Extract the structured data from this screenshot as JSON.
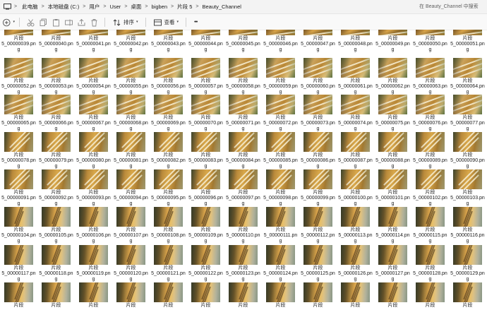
{
  "address_bar": {
    "breadcrumbs": [
      "此电脑",
      "本地磁盘 (C:)",
      "用户",
      "User",
      "桌面",
      "bigben",
      "片段 5",
      "Beauty_Channel"
    ],
    "search_placeholder": "在 Beauty_Channel 中搜索"
  },
  "toolbar": {
    "sort_label": "排序",
    "view_label": "查看",
    "more_label": "•••"
  },
  "files": {
    "first_partial_index": 39,
    "name_prefix": "片段",
    "name_suffix": ".png",
    "rows": [
      [
        {
          "line1": "5_00000039.pn",
          "line2": "g"
        },
        {
          "line1": "5_00000040.pn",
          "line2": "g"
        },
        {
          "line1": "5_00000041.pn",
          "line2": "g"
        },
        {
          "line1": "5_00000042.pn",
          "line2": "g"
        },
        {
          "line1": "5_00000043.pn",
          "line2": "g"
        },
        {
          "line1": "5_00000044.pn",
          "line2": "g"
        },
        {
          "line1": "5_00000045.pn",
          "line2": "g"
        },
        {
          "line1": "5_00000046.pn",
          "line2": "g"
        },
        {
          "line1": "5_00000047.pn",
          "line2": "g"
        },
        {
          "line1": "5_00000048.pn",
          "line2": "g"
        },
        {
          "line1": "5_00000049.pn",
          "line2": "g"
        },
        {
          "line1": "5_00000050.pn",
          "line2": "g"
        },
        {
          "line1": "5_00000051.pn",
          "line2": "g"
        }
      ],
      [
        {
          "line1": "5_00000052.pn",
          "line2": "g"
        },
        {
          "line1": "5_00000053.pn",
          "line2": "g"
        },
        {
          "line1": "5_00000054.pn",
          "line2": "g"
        },
        {
          "line1": "5_00000055.pn",
          "line2": "g"
        },
        {
          "line1": "5_00000056.pn",
          "line2": "g"
        },
        {
          "line1": "5_00000057.pn",
          "line2": "g"
        },
        {
          "line1": "5_00000058.pn",
          "line2": "g"
        },
        {
          "line1": "5_00000059.pn",
          "line2": "g"
        },
        {
          "line1": "5_00000060.pn",
          "line2": "g"
        },
        {
          "line1": "5_00000061.pn",
          "line2": "g"
        },
        {
          "line1": "5_00000062.pn",
          "line2": "g"
        },
        {
          "line1": "5_00000063.pn",
          "line2": "g"
        },
        {
          "line1": "5_00000064.pn",
          "line2": "g"
        }
      ],
      [
        {
          "line1": "5_00000065.pn",
          "line2": "g"
        },
        {
          "line1": "5_00000066.pn",
          "line2": "g"
        },
        {
          "line1": "5_00000067.pn",
          "line2": "g"
        },
        {
          "line1": "5_00000068.pn",
          "line2": "g"
        },
        {
          "line1": "5_00000069.pn",
          "line2": "g"
        },
        {
          "line1": "5_00000070.pn",
          "line2": "g"
        },
        {
          "line1": "5_00000071.pn",
          "line2": "g"
        },
        {
          "line1": "5_00000072.pn",
          "line2": "g"
        },
        {
          "line1": "5_00000073.pn",
          "line2": "g"
        },
        {
          "line1": "5_00000074.pn",
          "line2": "g"
        },
        {
          "line1": "5_00000075.pn",
          "line2": "g"
        },
        {
          "line1": "5_00000076.pn",
          "line2": "g"
        },
        {
          "line1": "5_00000077.pn",
          "line2": "g"
        }
      ],
      [
        {
          "line1": "5_00000078.pn",
          "line2": "g"
        },
        {
          "line1": "5_00000079.pn",
          "line2": "g"
        },
        {
          "line1": "5_00000080.pn",
          "line2": "g"
        },
        {
          "line1": "5_00000081.pn",
          "line2": "g"
        },
        {
          "line1": "5_00000082.pn",
          "line2": "g"
        },
        {
          "line1": "5_00000083.pn",
          "line2": "g"
        },
        {
          "line1": "5_00000084.pn",
          "line2": "g"
        },
        {
          "line1": "5_00000085.pn",
          "line2": "g"
        },
        {
          "line1": "5_00000086.pn",
          "line2": "g"
        },
        {
          "line1": "5_00000087.pn",
          "line2": "g"
        },
        {
          "line1": "5_00000088.pn",
          "line2": "g"
        },
        {
          "line1": "5_00000089.pn",
          "line2": "g"
        },
        {
          "line1": "5_00000090.pn",
          "line2": "g"
        }
      ],
      [
        {
          "line1": "5_00000091.pn",
          "line2": "g"
        },
        {
          "line1": "5_00000092.pn",
          "line2": "g"
        },
        {
          "line1": "5_00000093.pn",
          "line2": "g"
        },
        {
          "line1": "5_00000094.pn",
          "line2": "g"
        },
        {
          "line1": "5_00000095.pn",
          "line2": "g"
        },
        {
          "line1": "5_00000096.pn",
          "line2": "g"
        },
        {
          "line1": "5_00000097.pn",
          "line2": "g"
        },
        {
          "line1": "5_00000098.pn",
          "line2": "g"
        },
        {
          "line1": "5_00000099.pn",
          "line2": "g"
        },
        {
          "line1": "5_00000100.pn",
          "line2": "g"
        },
        {
          "line1": "5_00000101.pn",
          "line2": "g"
        },
        {
          "line1": "5_00000102.pn",
          "line2": "g"
        },
        {
          "line1": "5_00000103.pn",
          "line2": "g"
        }
      ],
      [
        {
          "line1": "5_00000104.pn",
          "line2": "g"
        },
        {
          "line1": "5_00000105.pn",
          "line2": "g"
        },
        {
          "line1": "5_00000106.pn",
          "line2": "g"
        },
        {
          "line1": "5_00000107.pn",
          "line2": "g"
        },
        {
          "line1": "5_00000108.pn",
          "line2": "g"
        },
        {
          "line1": "5_00000109.pn",
          "line2": "g"
        },
        {
          "line1": "5_00000110.pn",
          "line2": "g"
        },
        {
          "line1": "5_00000111.pn",
          "line2": "g"
        },
        {
          "line1": "5_00000112.pn",
          "line2": "g"
        },
        {
          "line1": "5_00000113.pn",
          "line2": "g"
        },
        {
          "line1": "5_00000114.pn",
          "line2": "g"
        },
        {
          "line1": "5_00000115.pn",
          "line2": "g"
        },
        {
          "line1": "5_00000116.pn",
          "line2": "g"
        }
      ],
      [
        {
          "line1": "5_00000117.pn",
          "line2": "g"
        },
        {
          "line1": "5_00000118.pn",
          "line2": "g"
        },
        {
          "line1": "5_00000119.pn",
          "line2": "g"
        },
        {
          "line1": "5_00000120.pn",
          "line2": "g"
        },
        {
          "line1": "5_00000121.pn",
          "line2": "g"
        },
        {
          "line1": "5_00000122.pn",
          "line2": "g"
        },
        {
          "line1": "5_00000123.pn",
          "line2": "g"
        },
        {
          "line1": "5_00000124.pn",
          "line2": "g"
        },
        {
          "line1": "5_00000125.pn",
          "line2": "g"
        },
        {
          "line1": "5_00000126.pn",
          "line2": "g"
        },
        {
          "line1": "5_00000127.pn",
          "line2": "g"
        },
        {
          "line1": "5_00000128.pn",
          "line2": "g"
        },
        {
          "line1": "5_00000129.pn",
          "line2": "g"
        }
      ],
      [
        {
          "line1": "",
          "line2": ""
        },
        {
          "line1": "",
          "line2": ""
        },
        {
          "line1": "",
          "line2": ""
        },
        {
          "line1": "",
          "line2": ""
        },
        {
          "line1": "",
          "line2": ""
        },
        {
          "line1": "",
          "line2": ""
        },
        {
          "line1": "",
          "line2": ""
        },
        {
          "line1": "",
          "line2": ""
        },
        {
          "line1": "",
          "line2": ""
        },
        {
          "line1": "",
          "line2": ""
        },
        {
          "line1": "",
          "line2": ""
        },
        {
          "line1": "",
          "line2": ""
        },
        {
          "line1": "",
          "line2": ""
        }
      ]
    ]
  },
  "icons": {
    "monitor": "monitor-icon",
    "chevron": "chevron-right-icon",
    "new": "new-item-icon",
    "cut": "cut-icon",
    "copy": "copy-icon",
    "paste": "paste-icon",
    "rename": "rename-icon",
    "share": "share-icon",
    "delete": "delete-icon",
    "sort": "sort-icon",
    "view": "view-icon"
  },
  "colors": {
    "toolbar_bg": "#f9f9f9",
    "address_bg": "#f3f3f3",
    "thumbnail_gold": "#d8a44a"
  }
}
